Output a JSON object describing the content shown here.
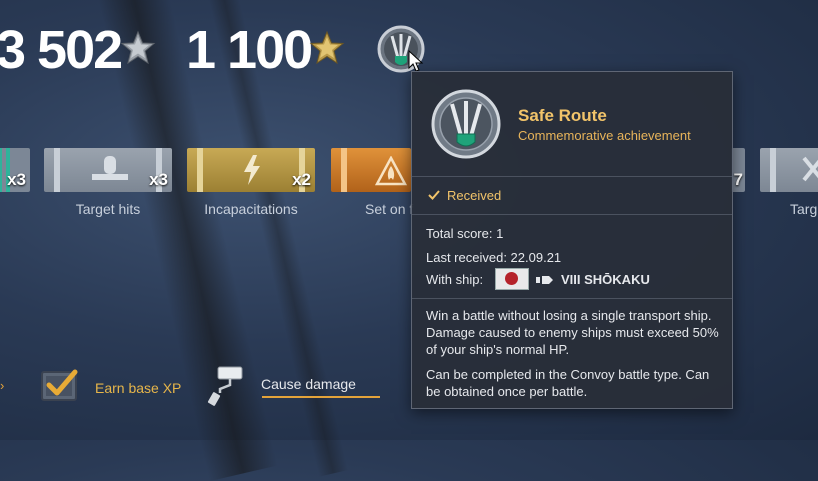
{
  "stats": {
    "left_value": "3 502",
    "right_value": "1 100"
  },
  "ribbons": [
    {
      "label": "",
      "count": "x3"
    },
    {
      "label": "Target hits",
      "count": "x3"
    },
    {
      "label": "Incapacitations",
      "count": "x2"
    },
    {
      "label": "Set on f",
      "count": ""
    },
    {
      "label": "",
      "count": "7"
    },
    {
      "label": "Targ",
      "count": ""
    }
  ],
  "tasks": {
    "earn_xp_label": "Earn base XP",
    "cause_damage_label": "Cause damage"
  },
  "tooltip": {
    "title": "Safe Route",
    "subtitle": "Commemorative achievement",
    "status": "Received",
    "total_score": "Total score: 1",
    "last_received": "Last received: 22.09.21",
    "with_ship_label": "With ship:",
    "ship_name": "VIII SHŌKAKU",
    "description_1": "Win a battle without losing a single transport ship. Damage caused to enemy ships must exceed 50% of your ship's normal HP.",
    "description_2": "Can be completed in the Convoy battle type. Can be obtained once per battle."
  },
  "icons": [
    "silver-star-icon",
    "gold-star-icon",
    "safe-route-medal-icon",
    "checkmark-icon",
    "japan-flag-icon",
    "ship-class-icon",
    "paint-roller-icon"
  ],
  "colors": {
    "accent_gold": "#f2c46a",
    "progress_orange": "#e3a33a"
  }
}
